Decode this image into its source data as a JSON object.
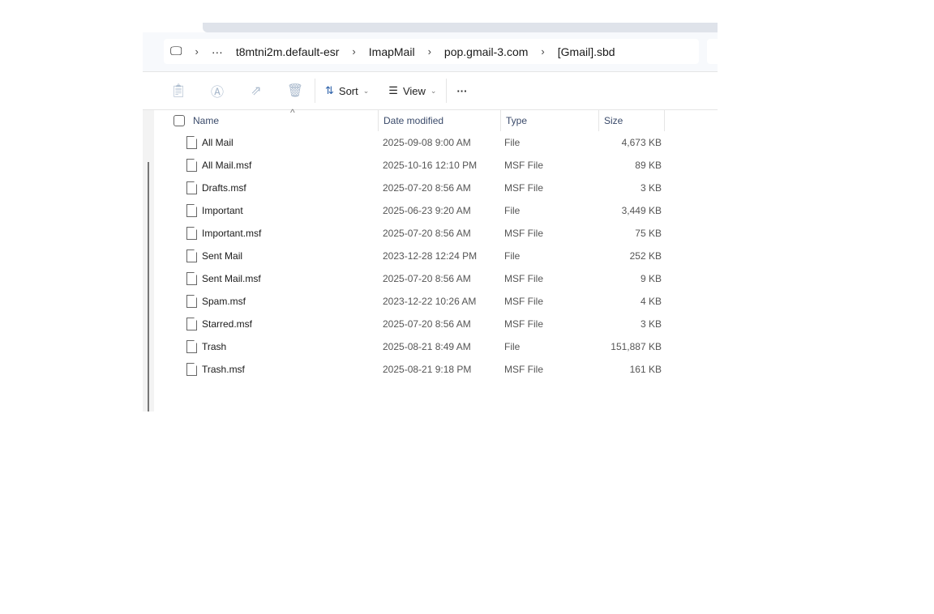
{
  "breadcrumb": {
    "overflow": "···",
    "items": [
      "t8mtni2m.default-esr",
      "ImapMail",
      "pop.gmail-3.com",
      "[Gmail].sbd"
    ]
  },
  "toolbar": {
    "sort": "Sort",
    "view": "View",
    "more": "···"
  },
  "columns": {
    "name": "Name",
    "date": "Date modified",
    "type": "Type",
    "size": "Size"
  },
  "files": [
    {
      "name": "All Mail",
      "date": "2025-09-08 9:00 AM",
      "type": "File",
      "size": "4,673 KB"
    },
    {
      "name": "All Mail.msf",
      "date": "2025-10-16 12:10 PM",
      "type": "MSF File",
      "size": "89 KB"
    },
    {
      "name": "Drafts.msf",
      "date": "2025-07-20 8:56 AM",
      "type": "MSF File",
      "size": "3 KB"
    },
    {
      "name": "Important",
      "date": "2025-06-23 9:20 AM",
      "type": "File",
      "size": "3,449 KB"
    },
    {
      "name": "Important.msf",
      "date": "2025-07-20 8:56 AM",
      "type": "MSF File",
      "size": "75 KB"
    },
    {
      "name": "Sent Mail",
      "date": "2023-12-28 12:24 PM",
      "type": "File",
      "size": "252 KB"
    },
    {
      "name": "Sent Mail.msf",
      "date": "2025-07-20 8:56 AM",
      "type": "MSF File",
      "size": "9 KB"
    },
    {
      "name": "Spam.msf",
      "date": "2023-12-22 10:26 AM",
      "type": "MSF File",
      "size": "4 KB"
    },
    {
      "name": "Starred.msf",
      "date": "2025-07-20 8:56 AM",
      "type": "MSF File",
      "size": "3 KB"
    },
    {
      "name": "Trash",
      "date": "2025-08-21 8:49 AM",
      "type": "File",
      "size": "151,887 KB"
    },
    {
      "name": "Trash.msf",
      "date": "2025-08-21 9:18 PM",
      "type": "MSF File",
      "size": "161 KB"
    }
  ]
}
